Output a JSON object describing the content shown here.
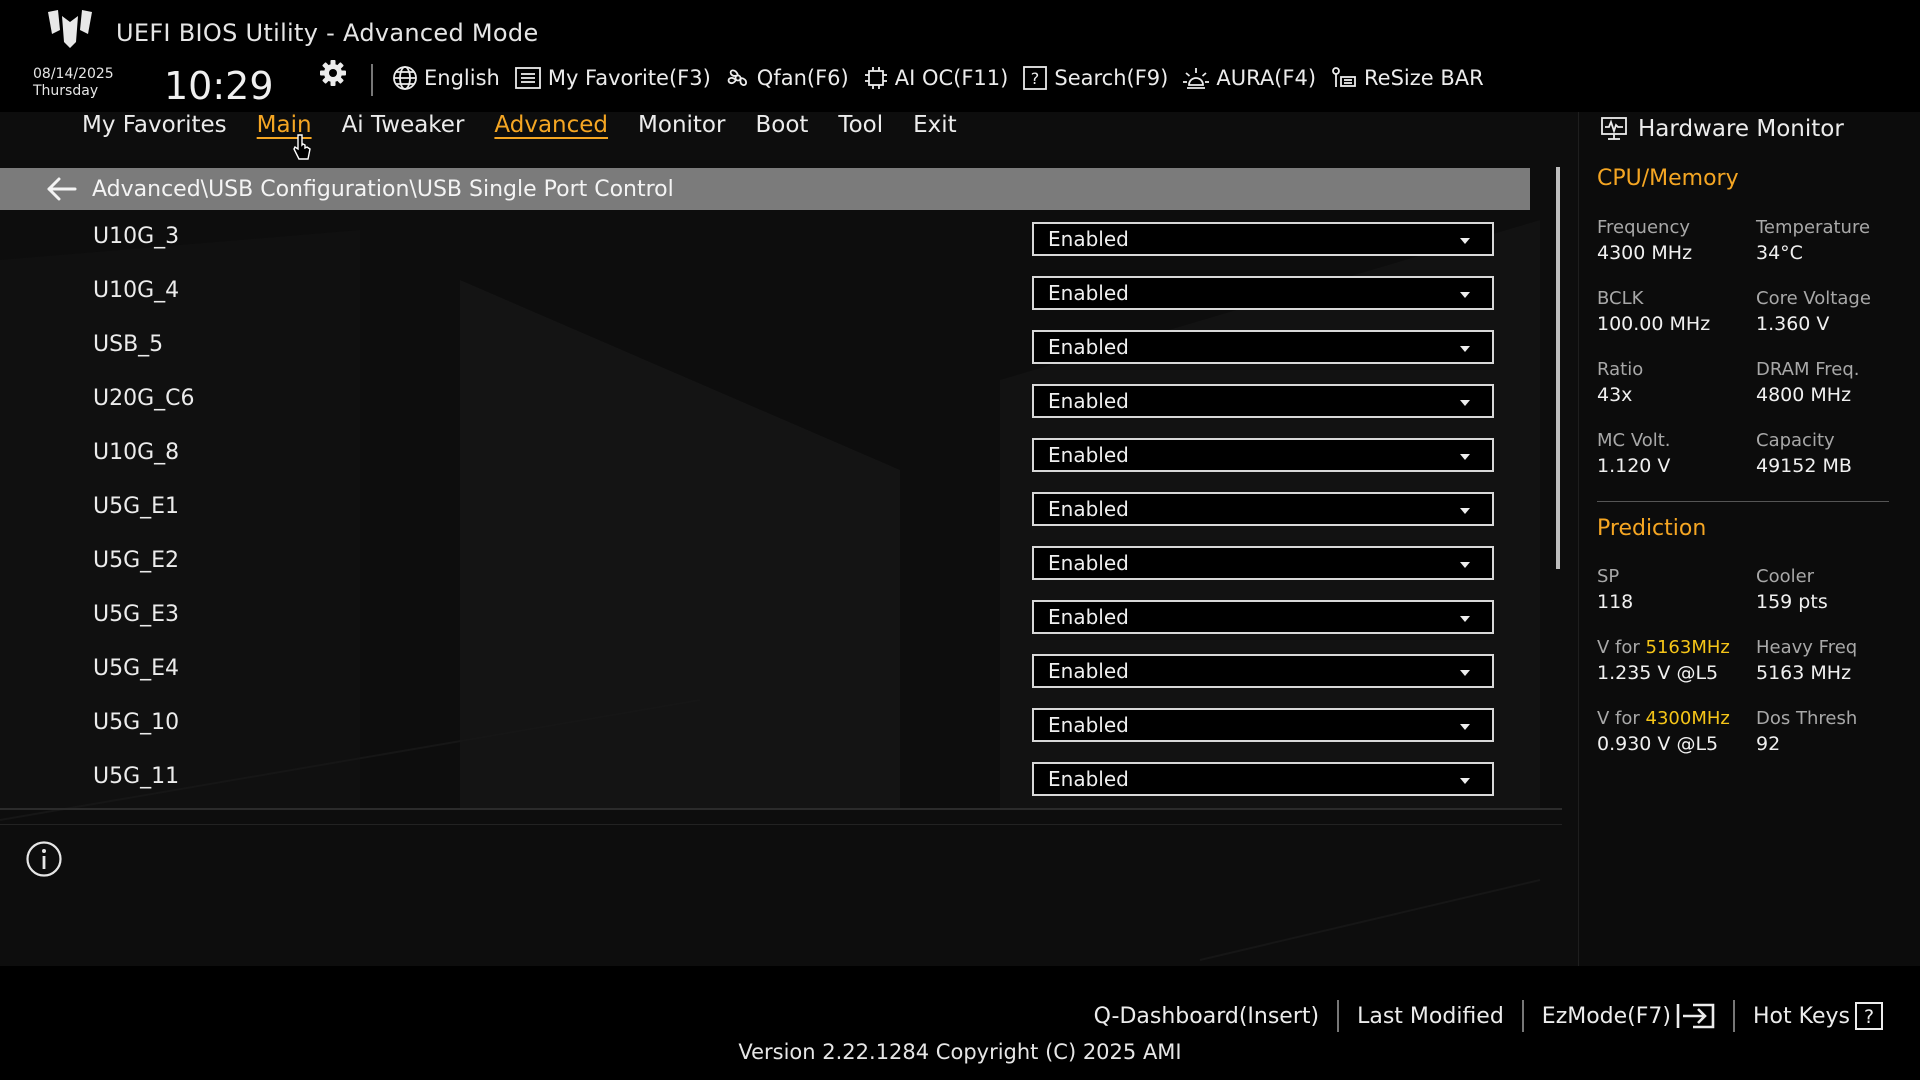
{
  "header": {
    "app_title": "UEFI BIOS Utility - Advanced Mode",
    "date": "08/14/2025",
    "weekday": "Thursday",
    "time": "10:29",
    "toolbar": [
      {
        "label": "English",
        "icon": "globe-icon"
      },
      {
        "label": "My Favorite(F3)",
        "icon": "favorite-list-icon"
      },
      {
        "label": "Qfan(F6)",
        "icon": "fan-icon"
      },
      {
        "label": "AI OC(F11)",
        "icon": "ai-chip-icon"
      },
      {
        "label": "Search(F9)",
        "icon": "search-help-icon"
      },
      {
        "label": "AURA(F4)",
        "icon": "aura-light-icon"
      },
      {
        "label": "ReSize BAR",
        "icon": "resize-bar-icon"
      }
    ]
  },
  "tabs": [
    {
      "label": "My Favorites",
      "highlight": false
    },
    {
      "label": "Main",
      "highlight": true
    },
    {
      "label": "Ai Tweaker",
      "highlight": false
    },
    {
      "label": "Advanced",
      "highlight": true
    },
    {
      "label": "Monitor",
      "highlight": false
    },
    {
      "label": "Boot",
      "highlight": false
    },
    {
      "label": "Tool",
      "highlight": false
    },
    {
      "label": "Exit",
      "highlight": false
    }
  ],
  "breadcrumb": "Advanced\\USB Configuration\\USB Single Port Control",
  "settings": [
    {
      "label": "U10G_3",
      "value": "Enabled"
    },
    {
      "label": "U10G_4",
      "value": "Enabled"
    },
    {
      "label": "USB_5",
      "value": "Enabled"
    },
    {
      "label": "U20G_C6",
      "value": "Enabled"
    },
    {
      "label": "U10G_8",
      "value": "Enabled"
    },
    {
      "label": "U5G_E1",
      "value": "Enabled"
    },
    {
      "label": "U5G_E2",
      "value": "Enabled"
    },
    {
      "label": "U5G_E3",
      "value": "Enabled"
    },
    {
      "label": "U5G_E4",
      "value": "Enabled"
    },
    {
      "label": "U5G_10",
      "value": "Enabled"
    },
    {
      "label": "U5G_11",
      "value": "Enabled"
    }
  ],
  "hw_monitor": {
    "title": "Hardware Monitor",
    "cpu_memory": {
      "title": "CPU/Memory",
      "items": [
        {
          "label": "Frequency",
          "value": "4300 MHz"
        },
        {
          "label": "Temperature",
          "value": "34°C"
        },
        {
          "label": "BCLK",
          "value": "100.00 MHz"
        },
        {
          "label": "Core Voltage",
          "value": "1.360 V"
        },
        {
          "label": "Ratio",
          "value": "43x"
        },
        {
          "label": "DRAM Freq.",
          "value": "4800 MHz"
        },
        {
          "label": "MC Volt.",
          "value": "1.120 V"
        },
        {
          "label": "Capacity",
          "value": "49152 MB"
        }
      ]
    },
    "prediction": {
      "title": "Prediction",
      "sp_label": "SP",
      "sp_value": "118",
      "cooler_label": "Cooler",
      "cooler_value": "159 pts",
      "v_for_prefix": "V for ",
      "v1_freq": "5163MHz",
      "v1_value": "1.235 V @L5",
      "heavy_label": "Heavy Freq",
      "heavy_value": "5163 MHz",
      "v2_freq": "4300MHz",
      "v2_value": "0.930 V @L5",
      "dos_label": "Dos Thresh",
      "dos_value": "92"
    }
  },
  "footer": {
    "links": [
      "Q-Dashboard(Insert)",
      "Last Modified",
      "EzMode(F7)",
      "Hot Keys"
    ],
    "version": "Version 2.22.1284 Copyright (C) 2025 AMI"
  },
  "colors": {
    "accent": "#f5a623",
    "highlight_freq": "#f5c518",
    "breadcrumb_bg": "#7b7b7b"
  }
}
